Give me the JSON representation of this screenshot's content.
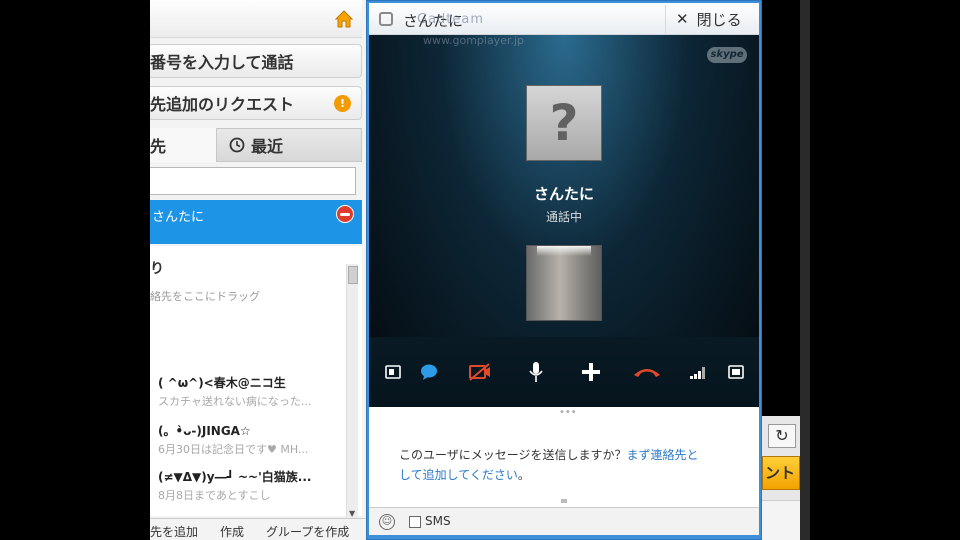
{
  "contacts_panel": {
    "dial_label": "番号を入力して通話",
    "request_label": "先追加のリクエスト",
    "request_badge": "!",
    "tab_contacts": "先",
    "tab_recent": "最近",
    "active_contact_name": "さんたに",
    "favorites_title": "り",
    "favorites_hint": "絡先をここにドラッグ",
    "contacts": [
      {
        "name": "( ^ω^)<春木@ニコ生",
        "mood": "スカチャ送れない病になった..."
      },
      {
        "name": "(。•̀ᴗ-)JINGA☆",
        "mood": "6月30日は記念日です♥ MH..."
      },
      {
        "name": "(≠▼Δ▼)y―┛ ~~'白猫族...",
        "mood": "8月8日まであとすこし"
      }
    ],
    "bottom_buttons": [
      "先を追加",
      "作成",
      "グループを作成"
    ]
  },
  "call_window": {
    "title": "さんたに",
    "close_label": "閉じる",
    "brand_logo": "skype",
    "watermark": "Gadteam",
    "watermark_url": "www.gomplayer.jp",
    "callee_name": "さんたに",
    "call_status": "通話中",
    "avatar_placeholder": "?",
    "message_prompt": "このユーザにメッセージを送信しますか？",
    "message_link": "まず連絡先として追加してください",
    "message_suffix": "。",
    "sms_label": "SMS",
    "end_call_color": "#e04a2a",
    "accent_color": "#1e94e6"
  },
  "right_app": {
    "refresh_glyph": "↻",
    "go_label": "ント"
  }
}
